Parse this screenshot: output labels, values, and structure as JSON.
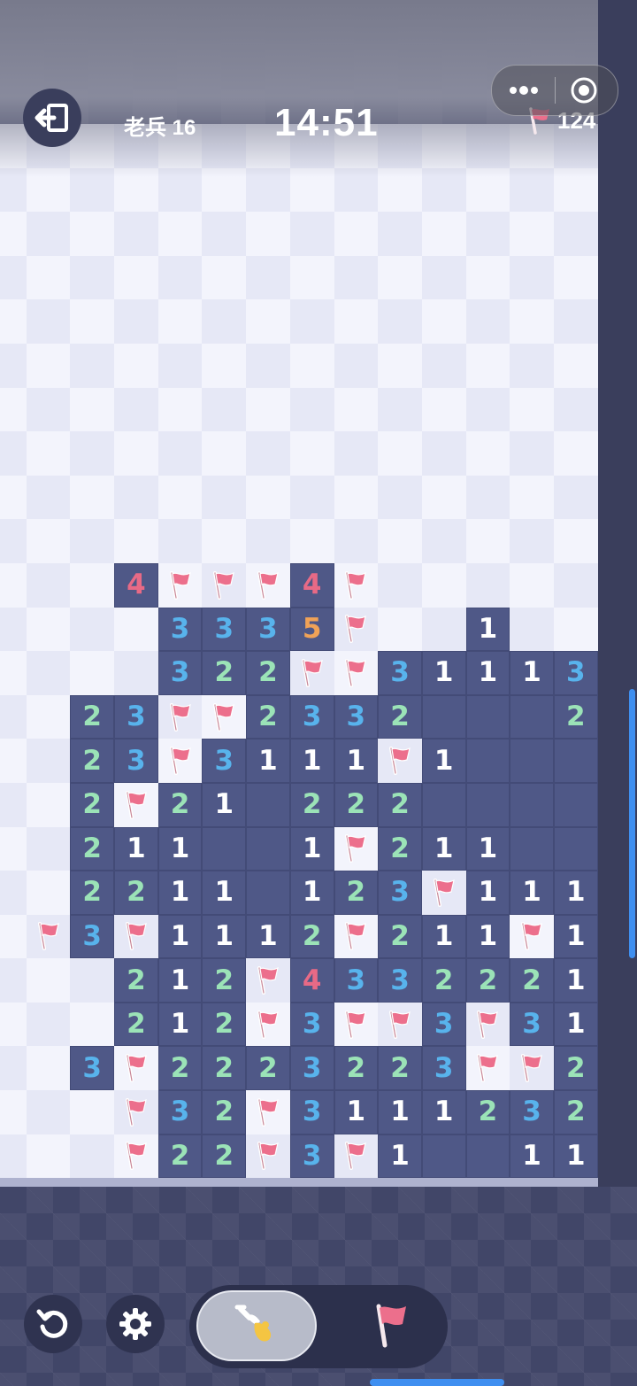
{
  "header": {
    "rank_label": "老兵 16",
    "timer": "14:51",
    "flags_remaining": "124"
  },
  "icons": {
    "exit": "exit-icon",
    "more": "more-dots-icon",
    "target": "target-icon",
    "flag": "flag-icon",
    "undo": "undo-icon",
    "settings": "gear-icon",
    "dig": "shovel-icon"
  },
  "colors": {
    "opened_cell": "#4f5887",
    "hidden_light": "#f3f4fc",
    "hidden_dark": "#e6e8f6",
    "num1": "#ffffff",
    "num2": "#9be3b7",
    "num3": "#58b3ec",
    "num4": "#e86a86",
    "num5": "#f0a257",
    "flag": "#ec6f8c"
  },
  "board": {
    "cols": 14,
    "rows": 24,
    "legend": "H = hidden, F = flag, O = opened empty, digit = opened number",
    "grid": [
      "HHHHHHHHHHHHHH",
      "HHHHHHHHHHHHHH",
      "HHHHHHHHHHHHHH",
      "HHHHHHHHHHHHHH",
      "HHHHHHHHHHHHHH",
      "HHHHHHHHHHHHHH",
      "HHHHHHHHHHHHHH",
      "HHHHHHHHHHHHHH",
      "HHHHHHHHHHHHHH",
      "HHHHHHHHHHHHHH",
      "HHH4FFF4FHHHHH",
      "HHHH3335FHH1HH2",
      "HHHH322FF3111 3F",
      "HH23FF2332OOO2F",
      "HH23F3111F1OOO11",
      "HH2F21O222OOOO",
      "HH211OO1F211OOO",
      "HH2211O123F1111",
      "HF3F1112F211F1",
      "HHH212F4332221",
      "HHH212F3FF3F31",
      "HH3F2223223FF2",
      "HHHF32F3111232F",
      "HHHF22F3F1OO11"
    ]
  }
}
